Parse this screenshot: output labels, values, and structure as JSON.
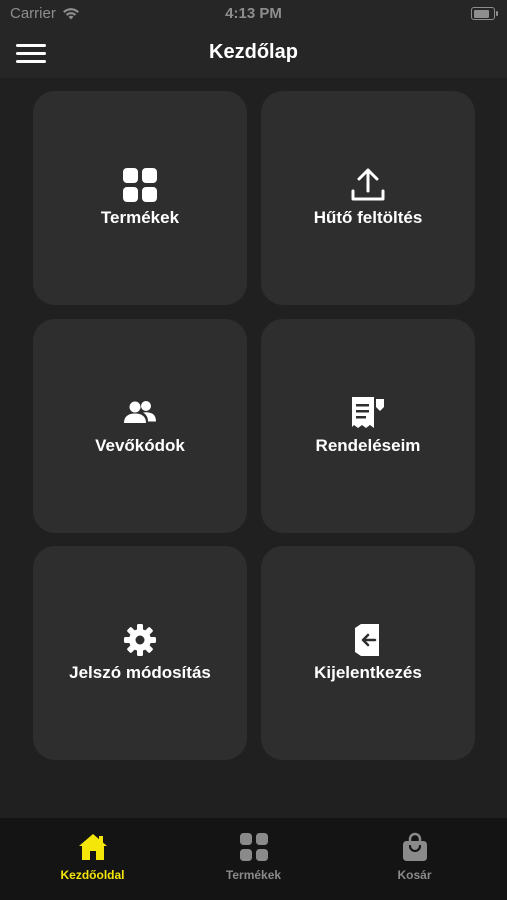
{
  "status_bar": {
    "carrier": "Carrier",
    "time": "4:13 PM",
    "battery_level": 0.9
  },
  "nav": {
    "title": "Kezdőlap",
    "menu_icon": "hamburger-menu-icon"
  },
  "tiles": [
    {
      "label": "Termékek",
      "icon": "grid-icon"
    },
    {
      "label": "Hűtő feltöltés",
      "icon": "upload-icon"
    },
    {
      "label": "Vevőkódok",
      "icon": "users-icon"
    },
    {
      "label": "Rendeléseim",
      "icon": "receipt-icon"
    },
    {
      "label": "Jelszó módosítás",
      "icon": "gear-icon"
    },
    {
      "label": "Kijelentkezés",
      "icon": "logout-icon"
    }
  ],
  "tab_bar": {
    "items": [
      {
        "label": "Kezdőoldal",
        "icon": "home-icon",
        "active": true
      },
      {
        "label": "Termékek",
        "icon": "grid-icon",
        "active": false
      },
      {
        "label": "Kosár",
        "icon": "shopping-bag-icon",
        "active": false
      }
    ],
    "active_color": "#f5e60a",
    "inactive_color": "#8a8a8a"
  },
  "colors": {
    "background": "#202020",
    "tile": "#2e2e2e",
    "accent": "#f5e60a"
  }
}
